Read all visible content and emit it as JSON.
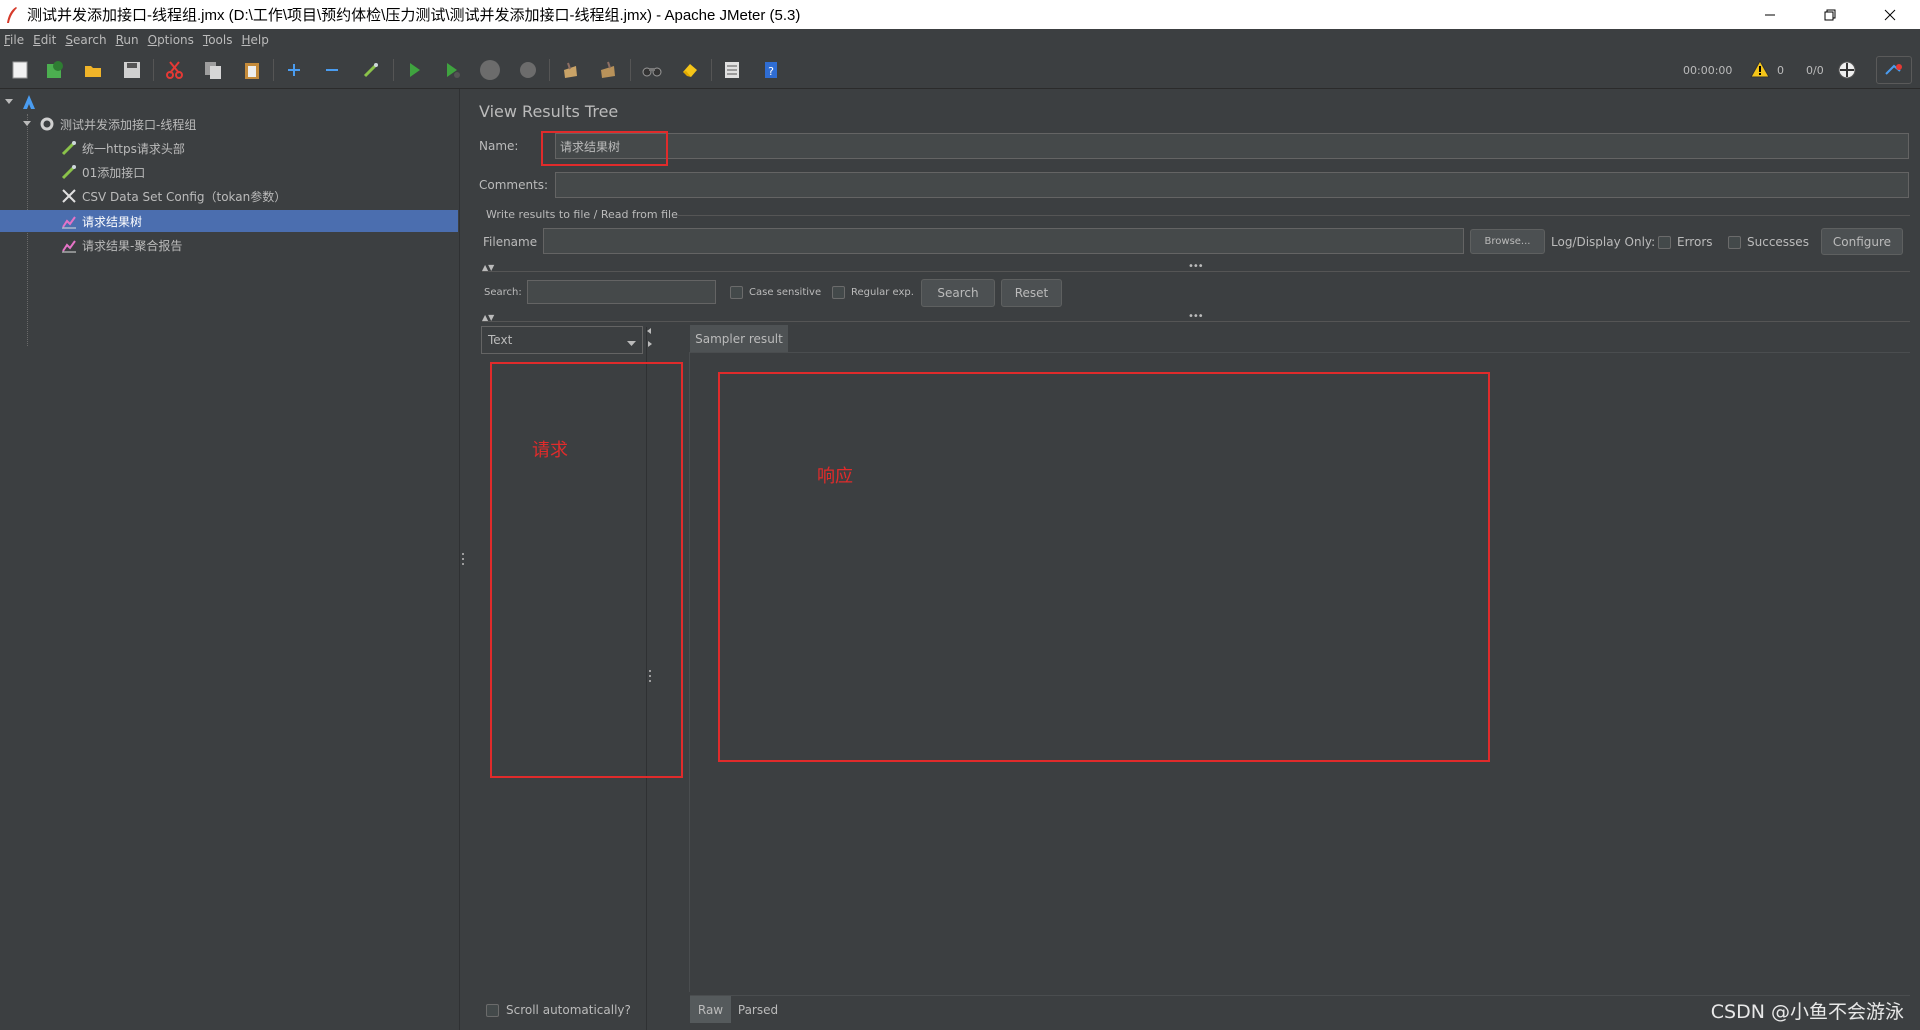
{
  "window": {
    "title": "测试并发添加接口-线程组.jmx (D:\\工作\\项目\\预约体检\\压力测试\\测试并发添加接口-线程组.jmx) - Apache JMeter (5.3)"
  },
  "menu": {
    "items": [
      "File",
      "Edit",
      "Search",
      "Run",
      "Options",
      "Tools",
      "Help"
    ],
    "mnemonics": [
      "F",
      "E",
      "S",
      "R",
      "O",
      "T",
      "H"
    ]
  },
  "toolbar": {
    "timer": "00:00:00",
    "warning_count": "0",
    "thread_count": "0/0"
  },
  "tree": {
    "items": [
      {
        "label": "",
        "icon": "test-plan-icon"
      },
      {
        "label": "测试并发添加接口-线程组",
        "icon": "gear-icon"
      },
      {
        "label": "统一https请求头部",
        "icon": "pipette-icon"
      },
      {
        "label": "01添加接口",
        "icon": "pipette-icon"
      },
      {
        "label": "CSV Data Set Config（tokan参数）",
        "icon": "scissors-icon"
      },
      {
        "label": "请求结果树",
        "icon": "chart-icon"
      },
      {
        "label": "请求结果-聚合报告",
        "icon": "chart-icon"
      }
    ]
  },
  "panel": {
    "title": "View Results Tree",
    "name_label": "Name:",
    "name_value": "请求结果树",
    "comments_label": "Comments:",
    "comments_value": "",
    "file_section": "Write results to file / Read from file",
    "filename_label": "Filename",
    "filename_value": "",
    "browse_button": "Browse...",
    "log_display_label": "Log/Display Only:",
    "errors_label": "Errors",
    "successes_label": "Successes",
    "configure_button": "Configure",
    "search_label": "Search:",
    "search_value": "",
    "case_sensitive_label": "Case sensitive",
    "regular_exp_label": "Regular exp.",
    "search_button": "Search",
    "reset_button": "Reset",
    "renderer_select": "Text",
    "sampler_result_tab": "Sampler result",
    "scroll_auto_label": "Scroll automatically?",
    "raw_tab": "Raw",
    "parsed_tab": "Parsed"
  },
  "annotations": {
    "request_label": "请求",
    "response_label": "响应",
    "color": "#e02b2b"
  },
  "watermark": "CSDN @小鱼不会游泳",
  "colors": {
    "background": "#3c3f41",
    "selection": "#4b6eaf",
    "text": "#bbbbbb"
  }
}
